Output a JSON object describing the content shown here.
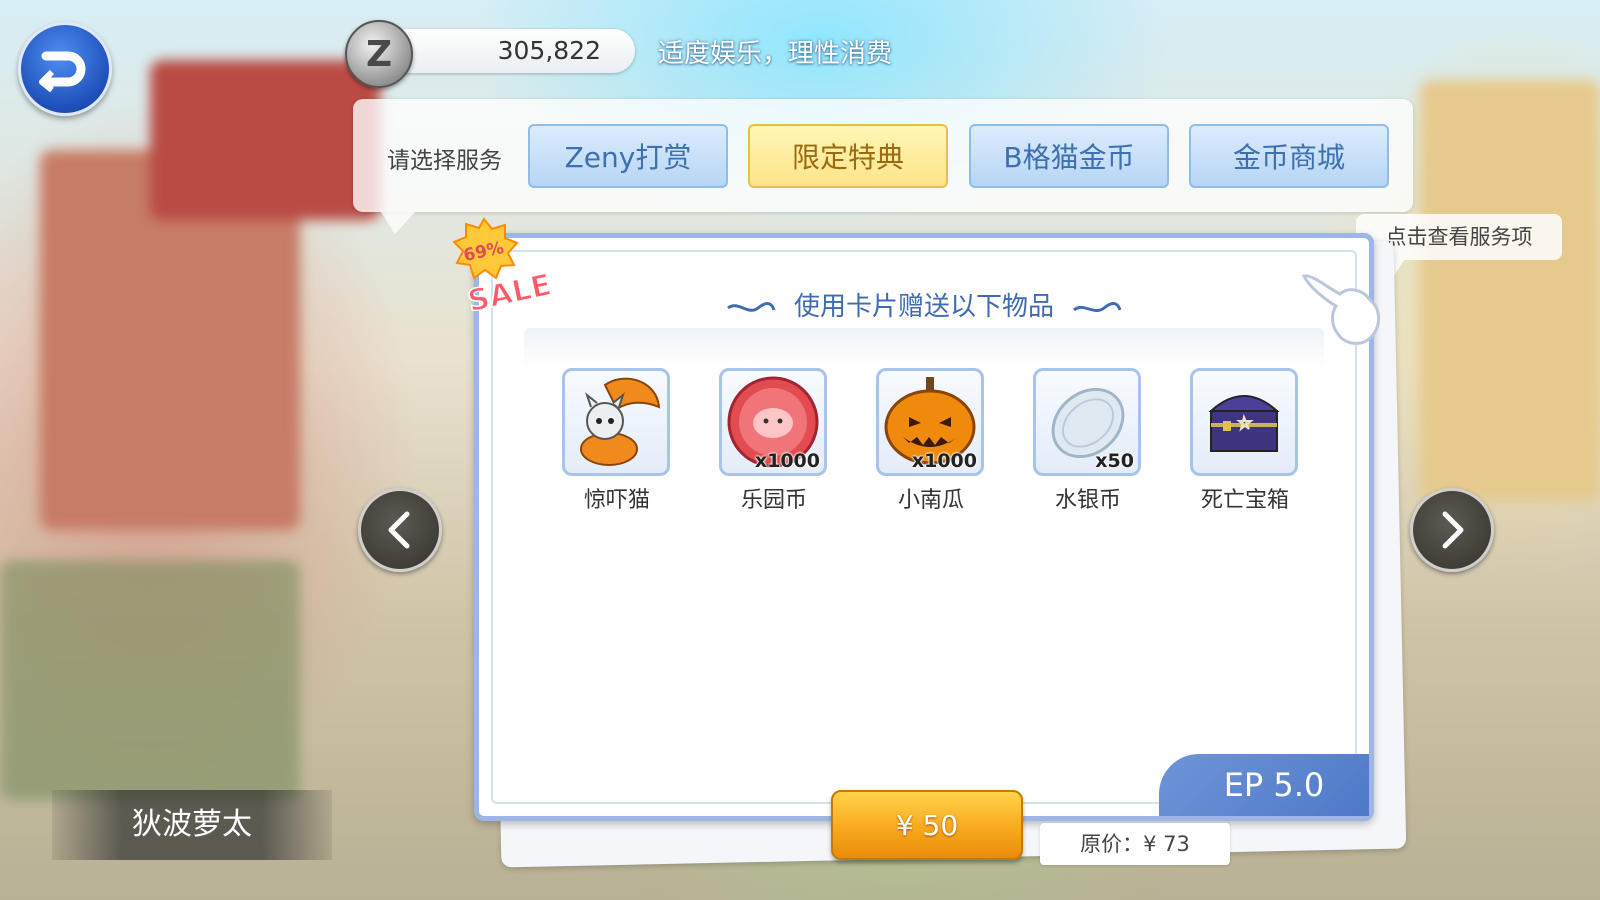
{
  "zeny": {
    "amount": "305,822",
    "coin_symbol": "Z"
  },
  "notice": "适度娱乐，理性消费",
  "service": {
    "label": "请选择服务",
    "tabs": [
      {
        "label": "Zeny打赏",
        "active": false
      },
      {
        "label": "限定特典",
        "active": true
      },
      {
        "label": "B格猫金币",
        "active": false
      },
      {
        "label": "金币商城",
        "active": false
      }
    ]
  },
  "hint": "点击查看服务项",
  "sale": {
    "percent": "69%",
    "word": "SALE"
  },
  "card": {
    "header": "使用卡片赠送以下物品",
    "items": [
      {
        "name": "惊吓猫",
        "qty": "",
        "icon": "pumpkin-cat-icon"
      },
      {
        "name": "乐园币",
        "qty": "x1000",
        "icon": "park-coin-icon"
      },
      {
        "name": "小南瓜",
        "qty": "x1000",
        "icon": "pumpkin-icon"
      },
      {
        "name": "水银币",
        "qty": "x50",
        "icon": "silver-coin-icon"
      },
      {
        "name": "死亡宝箱",
        "qty": "",
        "icon": "death-chest-icon"
      }
    ],
    "ep": "EP 5.0"
  },
  "price": {
    "buy": "¥ 50",
    "original": "原价：¥ 73"
  },
  "player": {
    "name": "狄波萝太"
  },
  "colors": {
    "accent_blue": "#3e6fae",
    "tab_active": "#fde48a",
    "buy_button": "#f7a51a"
  }
}
